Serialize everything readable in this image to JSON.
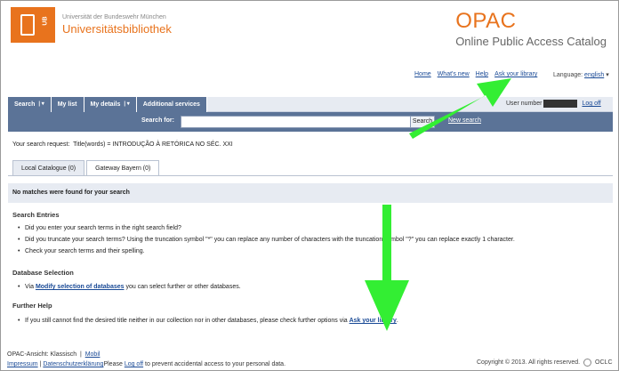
{
  "header": {
    "university": "Universität der Bundeswehr München",
    "library": "Universitätsbibliothek",
    "logo_label": "UB",
    "opac_title": "OPAC",
    "opac_subtitle": "Online Public Access Catalog"
  },
  "toplinks": [
    "Home",
    "What's new",
    "Help",
    "Ask your library"
  ],
  "language": {
    "label": "Language:",
    "value": "english"
  },
  "menu": {
    "items": [
      "Search",
      "My list",
      "My details",
      "Additional services"
    ]
  },
  "user": {
    "label": "User number",
    "logoff": "Log off"
  },
  "search": {
    "label": "Search for:",
    "value": "",
    "button": "Search",
    "new_search": "New search"
  },
  "request": {
    "label": "Your search request:",
    "query": "Title(words) = INTRODUÇÃO À RETÓRICA NO SÉC. XXI"
  },
  "tabs": [
    "Local Catalogue (0)",
    "Gateway Bayern (0)"
  ],
  "no_matches": "No matches were found for your search",
  "sections": {
    "entries": {
      "title": "Search Entries",
      "items": [
        "Did you enter your search terms in the right search field?",
        "Did you truncate your search terms? Using the truncation symbol \"*\" you can replace any number of characters with the truncation symbol \"?\" you can replace exactly 1 character.",
        "Check your search terms and their spelling."
      ]
    },
    "database": {
      "title": "Database Selection",
      "pre": "Via ",
      "link": "Modify selection of databases",
      "post": " you can select further or other databases."
    },
    "help": {
      "title": "Further Help",
      "pre": "If you still cannot find the desired title neither in our collection nor in other databases, please check further options via ",
      "link": "Ask your library",
      "post": "."
    }
  },
  "footer": {
    "view_label": "OPAC-Ansicht:",
    "view_current": "Klassisch",
    "view_sep": "|",
    "view_mobile": "Mobil",
    "impressum": "Impressum",
    "sep": "|",
    "privacy": "Datenschutzerklärung",
    "please": "Please ",
    "logoff": "Log off",
    "logoff_note": " to prevent accidental access to your personal data.",
    "copyright": "Copyright © 2013. All rights reserved.",
    "oclc": "OCLC"
  },
  "colors": {
    "brand": "#e8731d",
    "menu": "#5b7397",
    "arrow": "#33ee33"
  }
}
